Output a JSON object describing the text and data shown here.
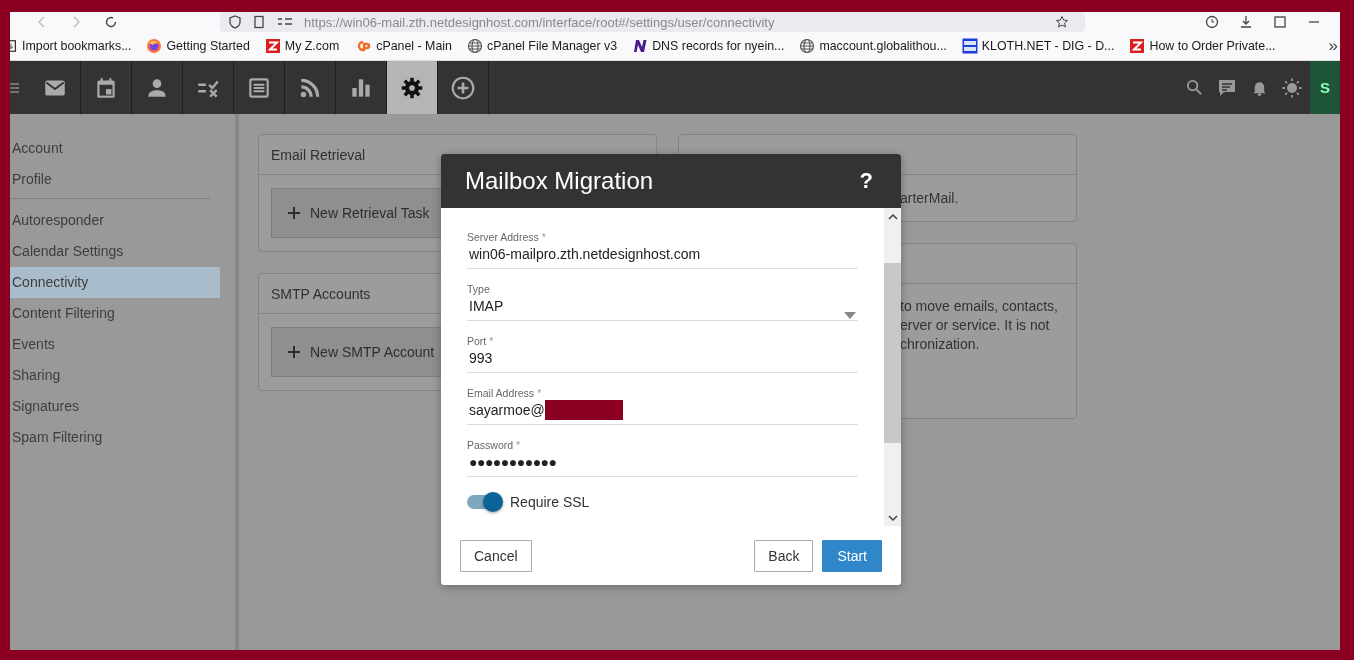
{
  "browser": {
    "url": "https://win06-mail.zth.netdesignhost.com/interface/root#/settings/user/connectivity",
    "bookmarks": [
      {
        "label": "Import bookmarks...",
        "kind": "import"
      },
      {
        "label": "Getting Started",
        "kind": "fox"
      },
      {
        "label": "My Z.com",
        "kind": "zed"
      },
      {
        "label": "cPanel - Main",
        "kind": "cp"
      },
      {
        "label": "cPanel File Manager v3",
        "kind": "globe"
      },
      {
        "label": "DNS records for nyein...",
        "kind": "en"
      },
      {
        "label": "maccount.globalithou...",
        "kind": "globe"
      },
      {
        "label": "KLOTH.NET - DIG - D...",
        "kind": "dl"
      },
      {
        "label": "How to Order Private...",
        "kind": "zed"
      }
    ],
    "more": "»"
  },
  "toolbar": {
    "nav": [
      {
        "kind": "mail",
        "selected": false
      },
      {
        "kind": "calendar",
        "selected": false
      },
      {
        "kind": "contacts",
        "selected": false
      },
      {
        "kind": "tasks",
        "selected": false
      },
      {
        "kind": "notes",
        "selected": false
      },
      {
        "kind": "feeds",
        "selected": false
      },
      {
        "kind": "reports",
        "selected": false
      },
      {
        "kind": "settings",
        "selected": true
      },
      {
        "kind": "add",
        "selected": false
      }
    ],
    "avatar": "S"
  },
  "sidebar": {
    "groups": [
      [
        {
          "label": "Account",
          "selected": false
        },
        {
          "label": "Profile",
          "selected": false
        }
      ],
      [
        {
          "label": "Autoresponder",
          "selected": false
        },
        {
          "label": "Calendar Settings",
          "selected": false
        },
        {
          "label": "Connectivity",
          "selected": true
        },
        {
          "label": "Content Filtering",
          "selected": false
        },
        {
          "label": "Events",
          "selected": false
        },
        {
          "label": "Sharing",
          "selected": false
        },
        {
          "label": "Signatures",
          "selected": false
        },
        {
          "label": "Spam Filtering",
          "selected": false
        }
      ]
    ]
  },
  "cards_left": [
    {
      "title": "Email Retrieval",
      "button": "New Retrieval Task"
    },
    {
      "title": "SMTP Accounts",
      "button": "New SMTP Account"
    }
  ],
  "cards_right": [
    {
      "lines": [
        "arterMail."
      ]
    },
    {
      "lines": [
        "to move emails, contacts,",
        "erver or service. It is not",
        "chronization."
      ]
    }
  ],
  "dialog": {
    "title": "Mailbox Migration",
    "help": "?",
    "fields": [
      {
        "label": "Server Address",
        "mark": "*",
        "kind": "text",
        "value": "win06-mailpro.zth.netdesignhost.com"
      },
      {
        "label": "Type",
        "kind": "select",
        "value": "IMAP"
      },
      {
        "label": "Port",
        "mark": "*",
        "kind": "text",
        "value": "993"
      },
      {
        "label": "Email Address",
        "mark": "*",
        "kind": "text",
        "value": "sayarmoe@",
        "redacted": true
      },
      {
        "label": "Password",
        "mark": "*",
        "kind": "password",
        "value": "●●●●●●●●●●●"
      }
    ],
    "toggle": {
      "label": "Require SSL",
      "on": true
    },
    "buttons": [
      {
        "label": "Cancel",
        "kind": "plain"
      },
      {
        "label": "Back",
        "kind": "plain"
      },
      {
        "label": "Start",
        "kind": "primary"
      }
    ]
  }
}
